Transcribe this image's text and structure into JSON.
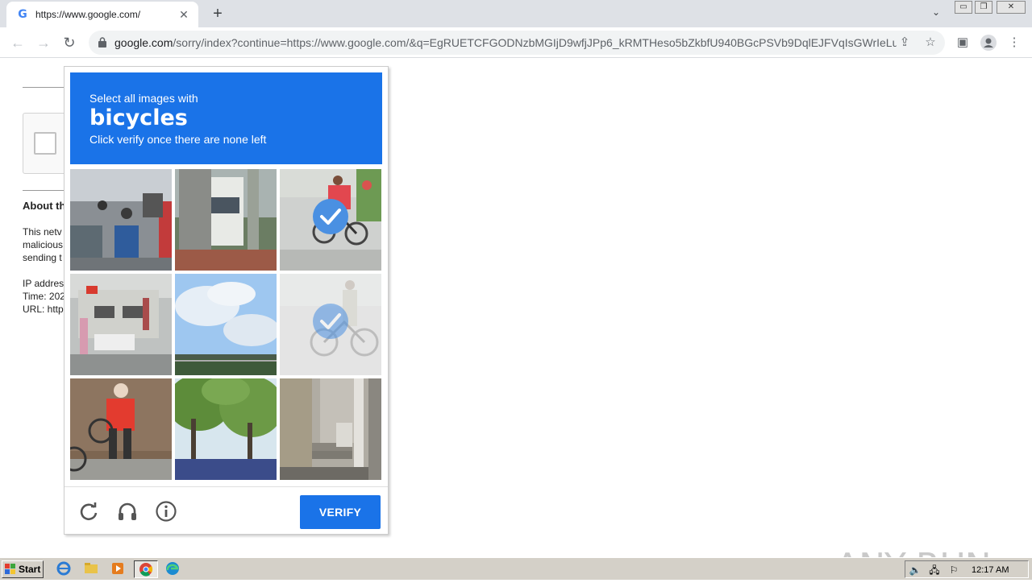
{
  "browser": {
    "tab_title": "https://www.google.com/",
    "tab_favicon": "G",
    "url_domain": "google.com",
    "url_path": "/sorry/index?continue=https://www.google.com/&q=EgRUETCFGODNzbMGIjD9wfjJPp6_kRMTHeso5bZkbfU940BGcPSVb9DqlEJFVqIsGWrIeLui..."
  },
  "page": {
    "about_title": "About th",
    "about_lines": [
      "This netv",
      "malicious",
      "sending t"
    ],
    "ip_lines": [
      "IP addres",
      "Time: 202",
      "URL: http"
    ]
  },
  "challenge": {
    "subtitle": "Select all images with",
    "keyword": "bicycles",
    "instruction": "Click verify once there are none left",
    "verify_label": "VERIFY",
    "tiles": [
      {
        "label": "street with motorbikes",
        "selected": false
      },
      {
        "label": "bus and pole",
        "selected": false
      },
      {
        "label": "cyclist in red",
        "selected": true
      },
      {
        "label": "building with flag",
        "selected": false
      },
      {
        "label": "sky and bridge",
        "selected": false
      },
      {
        "label": "bicycle rider",
        "selected": true
      },
      {
        "label": "person in red with bike",
        "selected": false
      },
      {
        "label": "trees",
        "selected": false
      },
      {
        "label": "stairs and pole",
        "selected": false
      }
    ],
    "accent": "#1a73e8"
  },
  "watermark": "ANY RUN",
  "taskbar": {
    "start_label": "Start",
    "clock": "12:17 AM"
  }
}
